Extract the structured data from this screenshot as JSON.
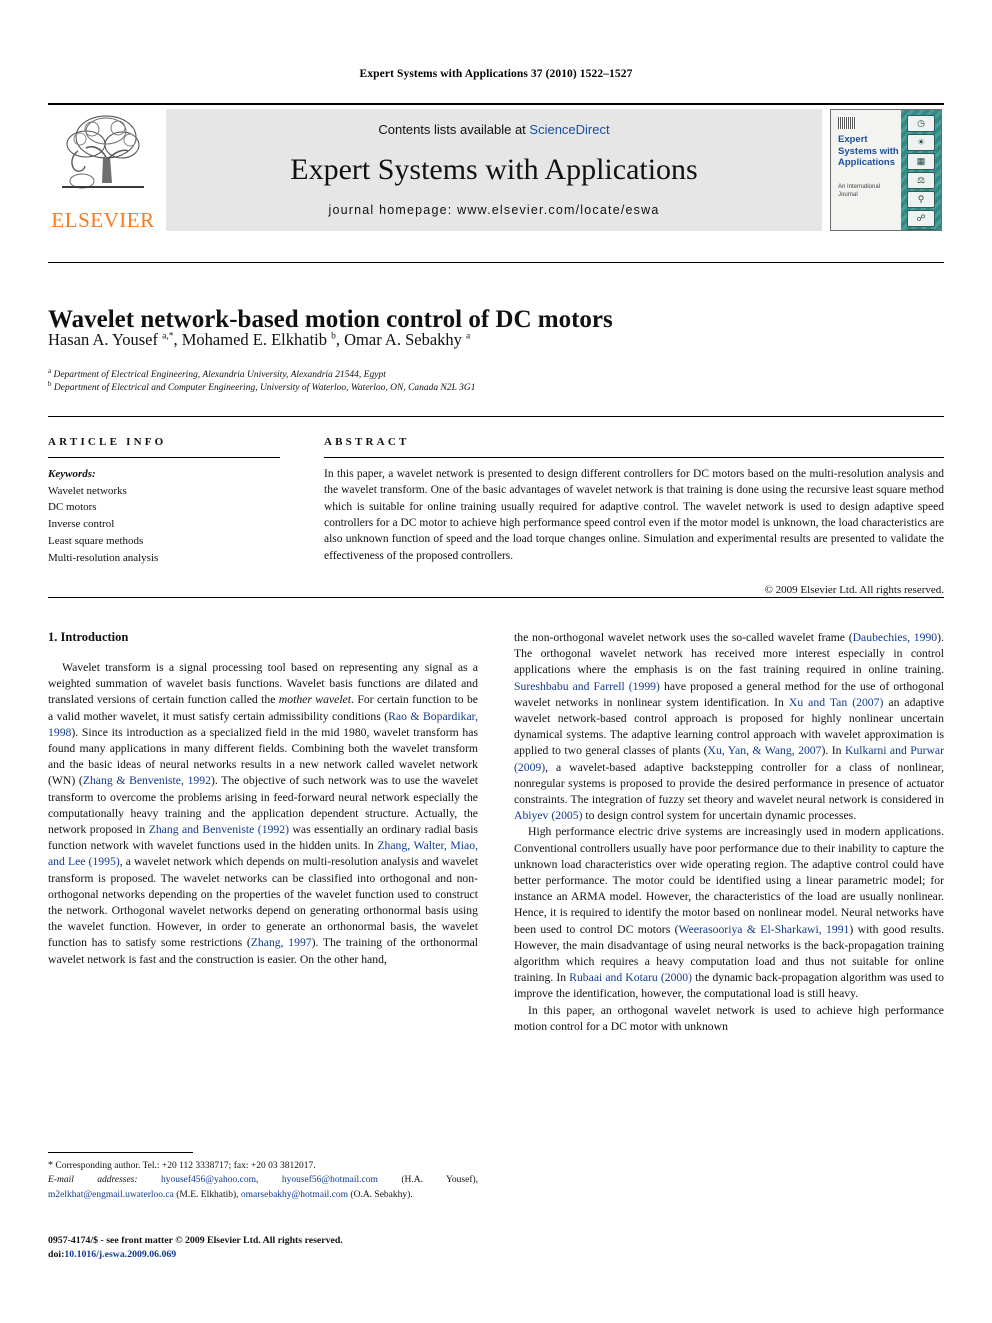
{
  "running_head": "Expert Systems with Applications 37 (2010) 1522–1527",
  "masthead": {
    "contents_prefix": "Contents lists available at ",
    "sciencedirect": "ScienceDirect",
    "journal_title": "Expert Systems with Applications",
    "homepage": "journal homepage: www.elsevier.com/locate/eswa",
    "publisher_wordmark": "ELSEVIER",
    "publisher_accent_color": "#f47b20",
    "cover": {
      "title": "Expert Systems with Applications",
      "subtitle": "An International Journal",
      "background_color": "#2f8a84",
      "title_color": "#1b4f9c",
      "icons": [
        "clock-icon",
        "globe-icon",
        "bar-chart-icon",
        "scales-icon",
        "microscope-icon",
        "satellite-icon",
        "flask-icon",
        "gauge-icon"
      ]
    }
  },
  "article": {
    "title": "Wavelet network-based motion control of DC motors",
    "authors_html": "Hasan A. Yousef <sup>a,*</sup>, Mohamed E. Elkhatib <sup>b</sup>, Omar A. Sebakhy <sup>a</sup>",
    "affiliation_a": "Department of Electrical Engineering, Alexandria University, Alexandria 21544, Egypt",
    "affiliation_b": "Department of Electrical and Computer Engineering, University of Waterloo, Waterloo, ON, Canada N2L 3G1"
  },
  "info": {
    "article_info_head": "ARTICLE INFO",
    "abstract_head": "ABSTRACT",
    "keywords_label": "Keywords:",
    "keywords": [
      "Wavelet networks",
      "DC motors",
      "Inverse control",
      "Least square methods",
      "Multi-resolution analysis"
    ],
    "abstract": "In this paper, a wavelet network is presented to design different controllers for DC motors based on the multi-resolution analysis and the wavelet transform. One of the basic advantages of wavelet network is that training is done using the recursive least square method which is suitable for online training usually required for adaptive control. The wavelet network is used to design adaptive speed controllers for a DC motor to achieve high performance speed control even if the motor model is unknown, the load characteristics are also unknown function of speed and the load torque changes online. Simulation and experimental results are presented to validate the effectiveness of the proposed controllers.",
    "copyright": "© 2009 Elsevier Ltd. All rights reserved."
  },
  "body": {
    "section_heading": "1. Introduction",
    "left_p1_pre": "Wavelet transform is a signal processing tool based on representing any signal as a weighted summation of wavelet basis functions. Wavelet basis functions are dilated and translated versions of certain function called the ",
    "left_p1_it1": "mother wavelet",
    "left_p1_mid1": ". For certain function to be a valid mother wavelet, it must satisfy certain admissibility conditions (",
    "left_cite1": "Rao & Bopardikar, 1998",
    "left_p1_mid2": "). Since its introduction as a specialized field in the mid 1980, wavelet transform has found many applications in many different fields. Combining both the wavelet transform and the basic ideas of neural networks results in a new network called wavelet network (WN) (",
    "left_cite2": "Zhang & Benveniste, 1992",
    "left_p1_mid3": "). The objective of such network was to use the wavelet transform to overcome the problems arising in feed-forward neural network especially the computationally heavy training and the application dependent structure. Actually, the network proposed in ",
    "left_cite3": "Zhang and Benveniste (1992)",
    "left_p1_mid4": " was essentially an ordinary radial basis function network with wavelet functions used in the hidden units. In ",
    "left_cite4": "Zhang, Walter, Miao, and Lee (1995)",
    "left_p1_mid5": ", a wavelet network which depends on multi-resolution analysis and wavelet transform is proposed. The wavelet networks can be classified into orthogonal and non-orthogonal networks depending on the properties of the wavelet function used to construct the network. Orthogonal wavelet networks depend on generating orthonormal basis using the wavelet function. However, in order to generate an orthonormal basis, the wavelet function has to satisfy some restrictions (",
    "left_cite5": "Zhang, 1997",
    "left_p1_end": "). The training of the orthonormal wavelet network is fast and the construction is easier. On the other hand,",
    "right_p1_pre": "the non-orthogonal wavelet network uses the so-called wavelet frame (",
    "right_cite1": "Daubechies, 1990",
    "right_p1_mid1": "). The orthogonal wavelet network has received more interest especially in control applications where the emphasis is on the fast training required in online training. ",
    "right_cite2": "Sureshbabu and Farrell (1999)",
    "right_p1_mid2": " have proposed a general method for the use of orthogonal wavelet networks in nonlinear system identification. In ",
    "right_cite3": "Xu and Tan (2007)",
    "right_p1_mid3": " an adaptive wavelet network-based control approach is proposed for highly nonlinear uncertain dynamical systems. The adaptive learning control approach with wavelet approximation is applied to two general classes of plants (",
    "right_cite4": "Xu, Yan, & Wang, 2007",
    "right_p1_mid4": "). In ",
    "right_cite5": "Kulkarni and Purwar (2009)",
    "right_p1_mid5": ", a wavelet-based adaptive backstepping controller for a class of nonlinear, nonregular systems is proposed to provide the desired performance in presence of actuator constraints. The integration of fuzzy set theory and wavelet neural network is considered in ",
    "right_cite6": "Abiyev (2005)",
    "right_p1_end": " to design control system for uncertain dynamic processes.",
    "right_p2_pre": "High performance electric drive systems are increasingly used in modern applications. Conventional controllers usually have poor performance due to their inability to capture the unknown load characteristics over wide operating region. The adaptive control could have better performance. The motor could be identified using a linear parametric model; for instance an ARMA model. However, the characteristics of the load are usually nonlinear. Hence, it is required to identify the motor based on nonlinear model. Neural networks have been used to control DC motors (",
    "right_cite7": "Weerasooriya & El-Sharkawi, 1991",
    "right_p2_mid1": ") with good results. However, the main disadvantage of using neural networks is the back-propagation training algorithm which requires a heavy computation load and thus not suitable for online training. In ",
    "right_cite8": "Rubaai and Kotaru (2000)",
    "right_p2_end": " the dynamic back-propagation algorithm was used to improve the identification, however, the computational load is still heavy.",
    "right_p3": "In this paper, an orthogonal wavelet network is used to achieve high performance motion control for a DC motor with unknown"
  },
  "footnotes": {
    "corresponding": "Corresponding author. Tel.: +20 112 3338717; fax: +20 03 3812017.",
    "email_label": "E-mail addresses:",
    "email_1": "hyousef456@yahoo.com",
    "email_2": "hyousef56@hotmail.com",
    "email_1_owner": "(H.A. Yousef)",
    "email_3": "m2elkhat@engmail.uwaterloo.ca",
    "email_3_owner": "(M.E. Elkhatib)",
    "email_4": "omarsebakhy@hotmail.com",
    "email_4_owner": "(O.A. Sebakhy)",
    "issn_line": "0957-4174/$ - see front matter © 2009 Elsevier Ltd. All rights reserved.",
    "doi_label": "doi:",
    "doi_value": "10.1016/j.eswa.2009.06.069"
  }
}
